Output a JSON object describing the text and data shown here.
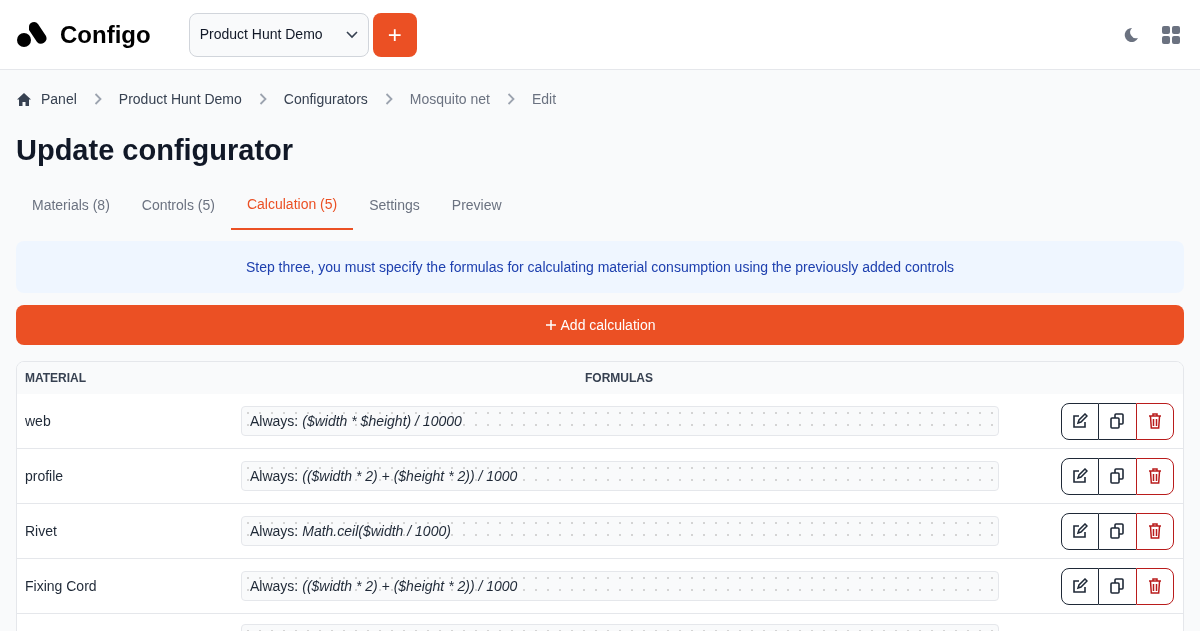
{
  "header": {
    "brand": "Configo",
    "project_select": {
      "value": "Product Hunt Demo"
    },
    "add_button": "+"
  },
  "breadcrumbs": [
    {
      "label": "Panel",
      "kind": "home"
    },
    {
      "label": "Product Hunt Demo",
      "kind": "link"
    },
    {
      "label": "Configurators",
      "kind": "link"
    },
    {
      "label": "Mosquito net",
      "kind": "muted"
    },
    {
      "label": "Edit",
      "kind": "muted"
    }
  ],
  "title": "Update configurator",
  "tabs": [
    {
      "label": "Materials (8)",
      "selected": false
    },
    {
      "label": "Controls (5)",
      "selected": false
    },
    {
      "label": "Calculation (5)",
      "selected": true
    },
    {
      "label": "Settings",
      "selected": false
    },
    {
      "label": "Preview",
      "selected": false
    }
  ],
  "info": "Step three, you must specify the formulas for calculating material consumption using the previously added controls",
  "add_calculation": "Add calculation",
  "table": {
    "columns": [
      "MATERIAL",
      "FORMULAS"
    ],
    "rows": [
      {
        "material": "web",
        "condition": "Always:",
        "expression": "($width * $height) / 10000"
      },
      {
        "material": "profile",
        "condition": "Always:",
        "expression": "(($width * 2) + ($height * 2)) / 1000"
      },
      {
        "material": "Rivet",
        "condition": "Always:",
        "expression": "Math.ceil($width / 1000)"
      },
      {
        "material": "Fixing Cord",
        "condition": "Always:",
        "expression": "(($width * 2) + ($height * 2)) / 1000"
      }
    ]
  }
}
